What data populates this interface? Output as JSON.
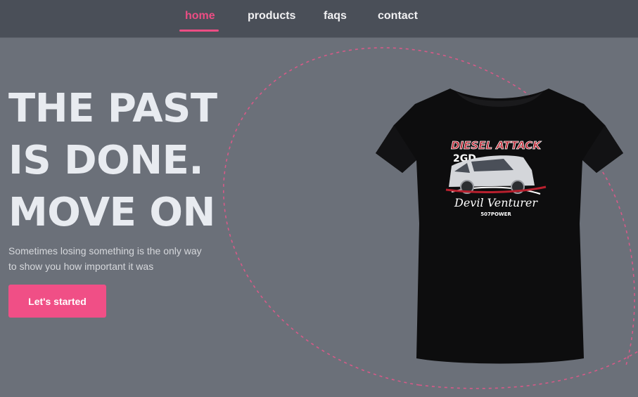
{
  "nav": {
    "items": [
      {
        "label": "home",
        "active": true
      },
      {
        "label": "products",
        "active": false
      },
      {
        "label": "faqs",
        "active": false
      },
      {
        "label": "contact",
        "active": false
      }
    ]
  },
  "hero": {
    "title_lines": [
      "THE PAST",
      "IS DONE.",
      "MOVE ON"
    ],
    "subtitle_lines": [
      "Sometimes losing something is the only way",
      "to show you how important it was"
    ],
    "cta_label": "Let's started"
  },
  "product": {
    "icon": "tshirt-product-image",
    "print_title": "DIESEL ATTACK",
    "print_code": "2GD",
    "print_brand": "Devil Venturer",
    "print_tag": "507POWER"
  },
  "colors": {
    "background": "#6b7079",
    "navbar": "#4a4f58",
    "accent": "#ec4d84",
    "title_text": "#e8ebf0",
    "shirt": "#0d0d0e"
  }
}
